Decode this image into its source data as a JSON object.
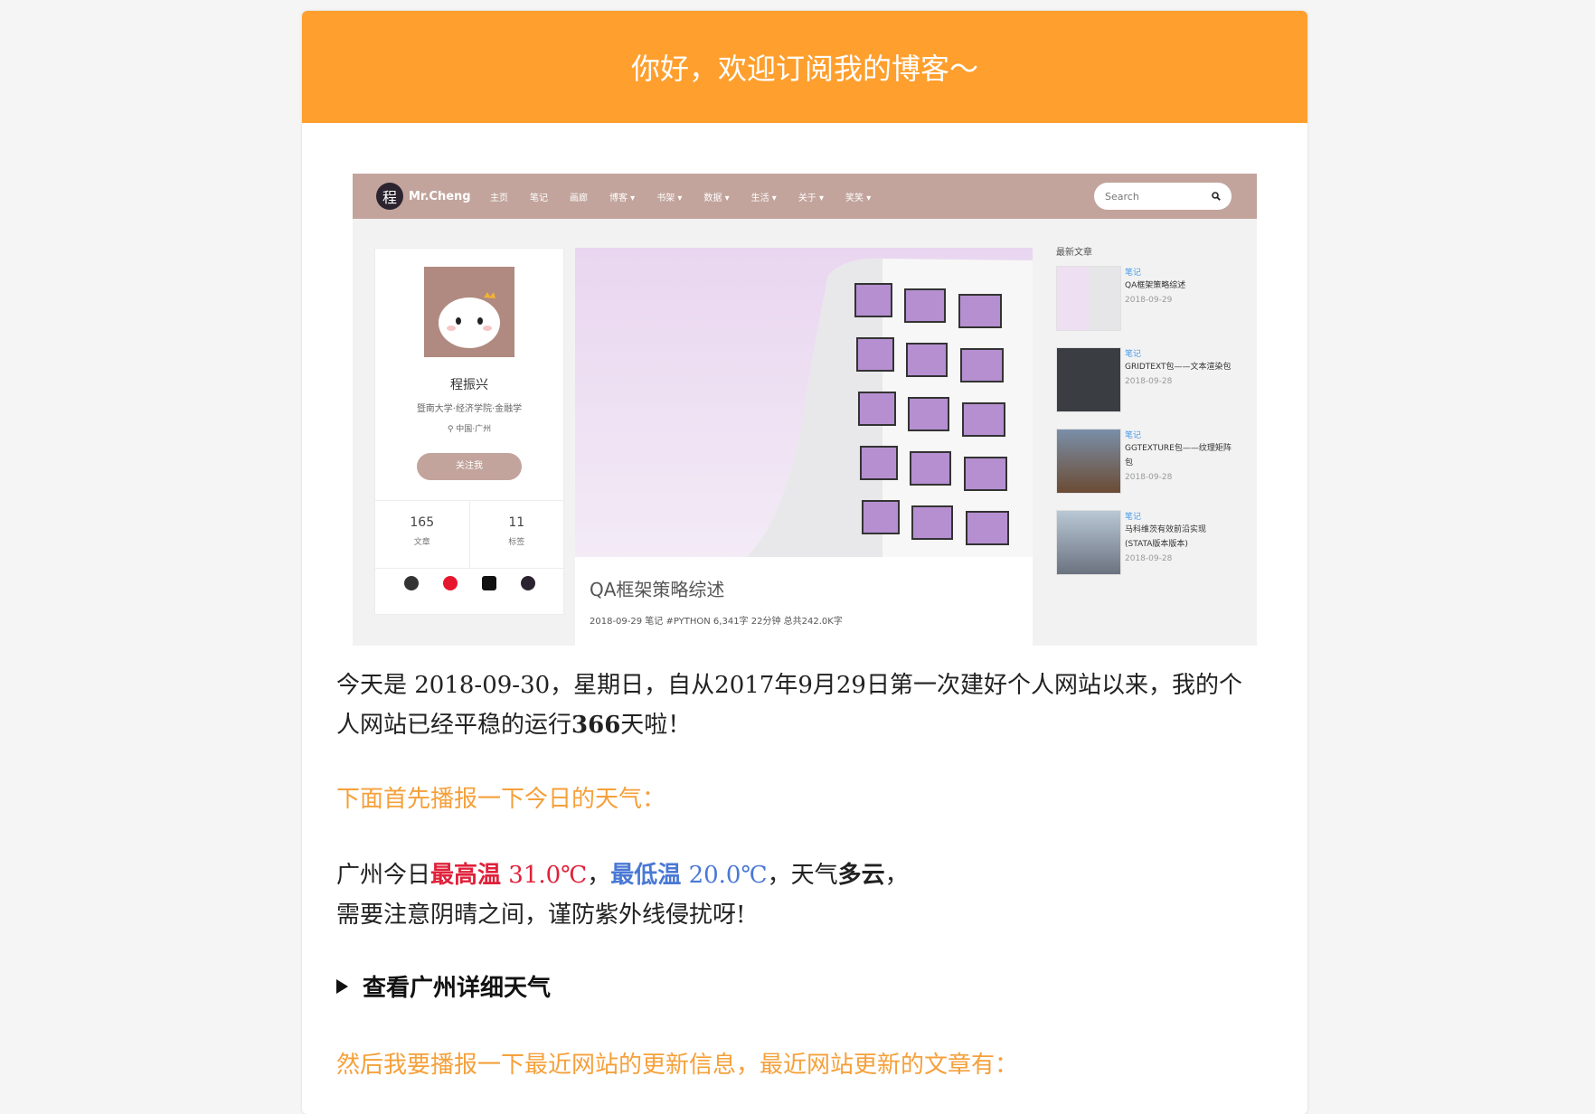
{
  "header": {
    "title": "你好，欢迎订阅我的博客～"
  },
  "shot": {
    "brand_logo": "程",
    "brand_name": "Mr.Cheng",
    "nav": [
      "主页",
      "笔记",
      "画廊",
      "博客 ▾",
      "书架 ▾",
      "数据 ▾",
      "生活 ▾",
      "关于 ▾",
      "笑笑 ▾"
    ],
    "search_placeholder": "Search",
    "profile": {
      "name": "程振兴",
      "school": "暨南大学·经济学院·金融学",
      "location": "中国·广州",
      "follow": "关注我",
      "stats": [
        {
          "num": "165",
          "label": "文章"
        },
        {
          "num": "11",
          "label": "标签"
        }
      ]
    },
    "post": {
      "title": "QA框架策略综述",
      "meta": "2018-09-29   笔记   #PYTHON   6,341字  22分钟  总共242.0K字"
    },
    "sidebar": {
      "title": "最新文章",
      "items": [
        {
          "cat": "笔记",
          "title": "QA框架策略综述",
          "date": "2018-09-29"
        },
        {
          "cat": "笔记",
          "title": "GRIDTEXT包——文本渲染包",
          "date": "2018-09-28"
        },
        {
          "cat": "笔记",
          "title": "GGTEXTURE包——纹理矩阵包",
          "date": "2018-09-28"
        },
        {
          "cat": "笔记",
          "title": "马科维茨有效前沿实现(STATA版本版本)",
          "date": "2018-09-28"
        }
      ]
    }
  },
  "body": {
    "p1a": "今天是 2018-09-30，星期日，自从2017年9月29日第一次建好个人网站以来，我的个",
    "p1b_pre": "人网站已经平稳的运行",
    "p1b_days": "366",
    "p1b_post": "天啦！",
    "weather_heading": "下面首先播报一下今日的天气：",
    "w_city": "广州今日",
    "w_high_label": "最高温",
    "w_high_value": " 31.0℃",
    "w_sep": "，",
    "w_low_label": "最低温",
    "w_low_value": " 20.0℃",
    "w_mid": "，天气",
    "w_condition": "多云",
    "w_end": "，",
    "w_tip": "需要注意阴晴之间，谨防紫外线侵扰呀!",
    "details_label": "查看广州详细天气",
    "update_heading": "然后我要播报一下最近网站的更新信息，最近网站更新的文章有："
  },
  "colors": {
    "header": "#ff9f2d",
    "orange_text": "#f5a03a",
    "high": "#e0213a",
    "low": "#4a78d4",
    "nav": "#c2a49c"
  }
}
